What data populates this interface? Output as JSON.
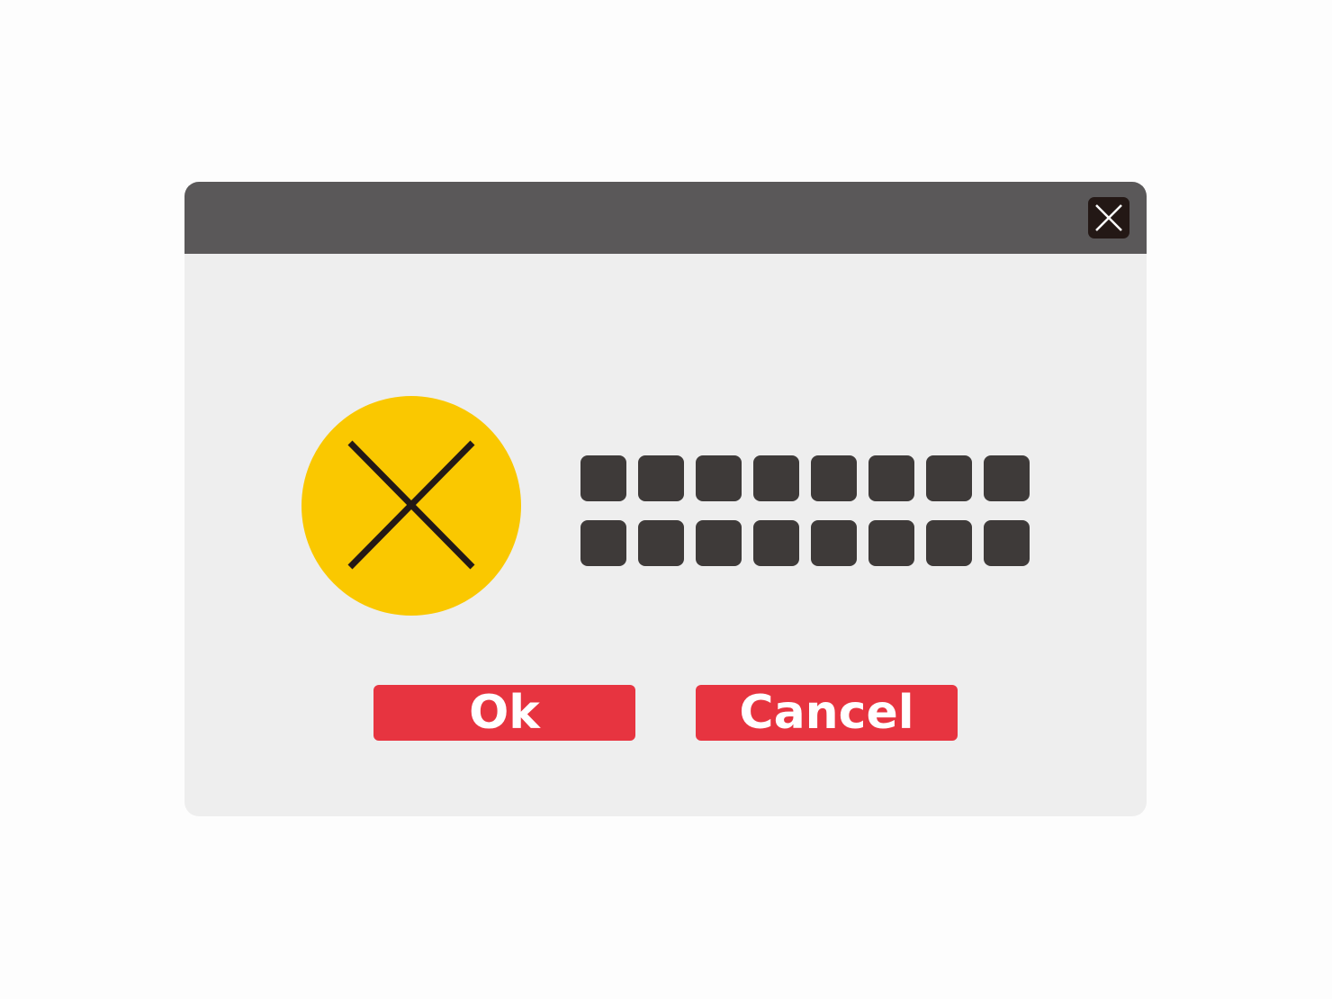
{
  "colors": {
    "page_background": "#fdfdfd",
    "titlebar": "#5a5859",
    "dialog_body": "#eeeeee",
    "close_button_bg": "#231815",
    "close_button_glyph": "#ffffff",
    "error_circle": "#fac800",
    "error_glyph": "#231815",
    "message_block": "#3e3a39",
    "button_bg": "#e73440",
    "button_text": "#ffffff"
  },
  "titlebar": {
    "close_icon": "close-icon"
  },
  "dialog": {
    "status_icon": "error-x-icon",
    "message": {
      "redacted_char_count": 16,
      "rows": 2
    }
  },
  "buttons": {
    "ok_label": "Ok",
    "cancel_label": "Cancel"
  }
}
